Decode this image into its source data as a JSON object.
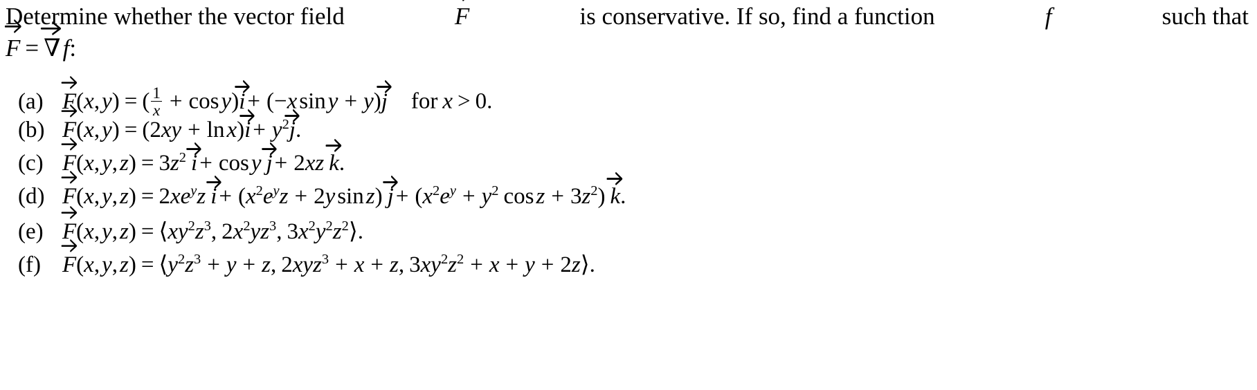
{
  "document": {
    "type": "math-problem",
    "stem": {
      "line1_left": "Determine whether the vector field",
      "line1_vector_symbol": "F",
      "line1_mid": "is conservative.  If so, find a function",
      "line1_function_symbol": "f",
      "line1_end": "such that",
      "line2": "F = ∇f:"
    },
    "parts": [
      {
        "tag": "(a)",
        "label": "a",
        "latex": "\\vec F(x,y) = (\\tfrac{1}{x} + \\cos y)\\vec\\imath + (-x\\sin y + y)\\vec\\jmath \\quad \\text{for } x > 0.",
        "plain": "F(x, y) = (1/x + cos y) i + (-x sin y + y) j   for x > 0.",
        "condition": "for x > 0."
      },
      {
        "tag": "(b)",
        "label": "b",
        "latex": "\\vec F(x,y) = (2xy + \\ln x)\\vec\\imath + y^2\\vec\\jmath.",
        "plain": "F(x, y) = (2xy + ln x) i + y^2 j."
      },
      {
        "tag": "(c)",
        "label": "c",
        "latex": "\\vec F(x,y,z) = 3z^2\\,\\vec\\imath + \\cos y\\,\\vec\\jmath + 2xz\\,\\vec k.",
        "plain": "F(x, y, z) = 3z^2 i + cos y j + 2xz k."
      },
      {
        "tag": "(d)",
        "label": "d",
        "latex": "\\vec F(x,y,z) = 2xe^{y}z\\,\\vec\\imath + (x^2e^{y}z + 2y\\sin z)\\,\\vec\\jmath + (x^2e^{y} + y^2\\cos z + 3z^2)\\,\\vec k.",
        "plain": "F(x, y, z) = 2x e^y z i + (x^2 e^y z + 2y sin z) j + (x^2 e^y + y^2 cos z + 3z^2) k."
      },
      {
        "tag": "(e)",
        "label": "e",
        "latex": "\\vec F(x,y,z) = \\langle xy^2z^3,\\, 2x^2yz^3,\\, 3x^2y^2z^2 \\rangle.",
        "plain": "F(x, y, z) = <x y^2 z^3, 2 x^2 y z^3, 3 x^2 y^2 z^2>."
      },
      {
        "tag": "(f)",
        "label": "f",
        "latex": "\\vec F(x,y,z) = \\langle y^2z^3 + y + z,\\, 2xyz^3 + x + z,\\, 3xy^2z^2 + x + y + 2z \\rangle.",
        "plain": "F(x, y, z) = <y^2 z^3 + y + z, 2x y z^3 + x + z, 3x y^2 z^2 + x + y + 2z>."
      }
    ],
    "symbols": {
      "i_hat": "i",
      "j_hat": "j",
      "k_hat": "k",
      "nabla": "∇",
      "f": "f",
      "F": "F",
      "x": "x",
      "y": "y",
      "z": "z",
      "e": "e",
      "cos": "cos",
      "sin": "sin",
      "ln": "ln",
      "for": "for",
      "equals": "=",
      "plus": "+",
      "minus": "−",
      "greater": ">",
      "zero": "0",
      "one": "1",
      "two": "2",
      "three": "3",
      "lparen": "(",
      "rparen": ")",
      "comma": ",",
      "period": ".",
      "colon": ":",
      "langle": "⟨",
      "rangle": "⟩"
    },
    "colors": {
      "ink": "#000000",
      "paper": "#ffffff"
    }
  }
}
